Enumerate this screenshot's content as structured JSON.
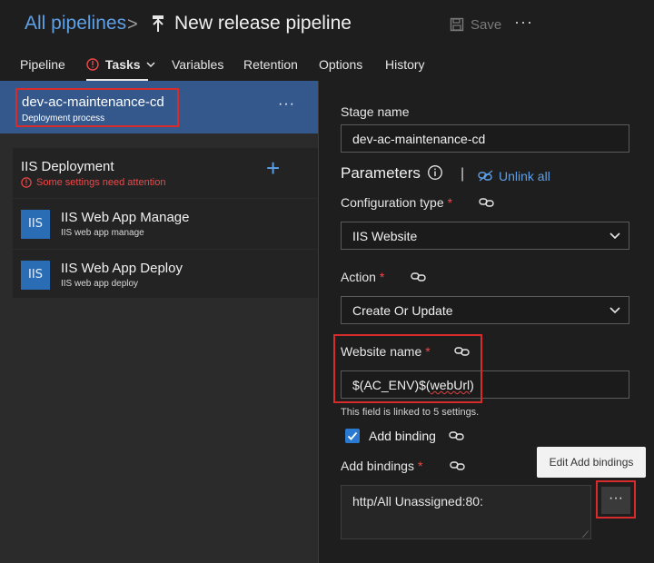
{
  "header": {
    "breadcrumb_root": "All pipelines",
    "separator": ">",
    "title": "New release pipeline",
    "save_label": "Save",
    "more_label": "···"
  },
  "tabs": [
    {
      "label": "Pipeline"
    },
    {
      "label": "Tasks",
      "active": true,
      "warning": true
    },
    {
      "label": "Variables"
    },
    {
      "label": "Retention"
    },
    {
      "label": "Options"
    },
    {
      "label": "History"
    }
  ],
  "stage": {
    "name": "dev-ac-maintenance-cd",
    "subtitle": "Deployment process",
    "more_label": "···"
  },
  "job": {
    "title": "IIS Deployment",
    "warning": "Some settings need attention",
    "add_label": "+"
  },
  "tasks": [
    {
      "icon_text": "IIS",
      "title": "IIS Web App Manage",
      "subtitle": "IIS web app manage"
    },
    {
      "icon_text": "IIS",
      "title": "IIS Web App Deploy",
      "subtitle": "IIS web app deploy"
    }
  ],
  "form": {
    "stage_name_label": "Stage name",
    "stage_name_value": "dev-ac-maintenance-cd",
    "parameters_title": "Parameters",
    "bar": "|",
    "unlink_all_label": "Unlink all",
    "config_type_label": "Configuration type",
    "config_type_value": "IIS Website",
    "action_label": "Action",
    "action_value": "Create Or Update",
    "website_name_label": "Website name",
    "website_name_value_a": "$(AC_ENV)$(",
    "website_name_value_b": "webUrl",
    "website_name_value_c": ")",
    "linked_hint": "This field is linked to 5 settings.",
    "add_binding_label": "Add binding",
    "add_binding_checked": true,
    "add_bindings_label": "Add bindings",
    "add_bindings_value": "http/All Unassigned:80:",
    "required_mark": "*",
    "edit_button_label": "···",
    "tooltip": "Edit Add bindings"
  },
  "colors": {
    "accent": "#5ea0e8",
    "stage_bg": "#34588c",
    "warning": "#f04848",
    "highlight_box": "#d82c2c"
  }
}
